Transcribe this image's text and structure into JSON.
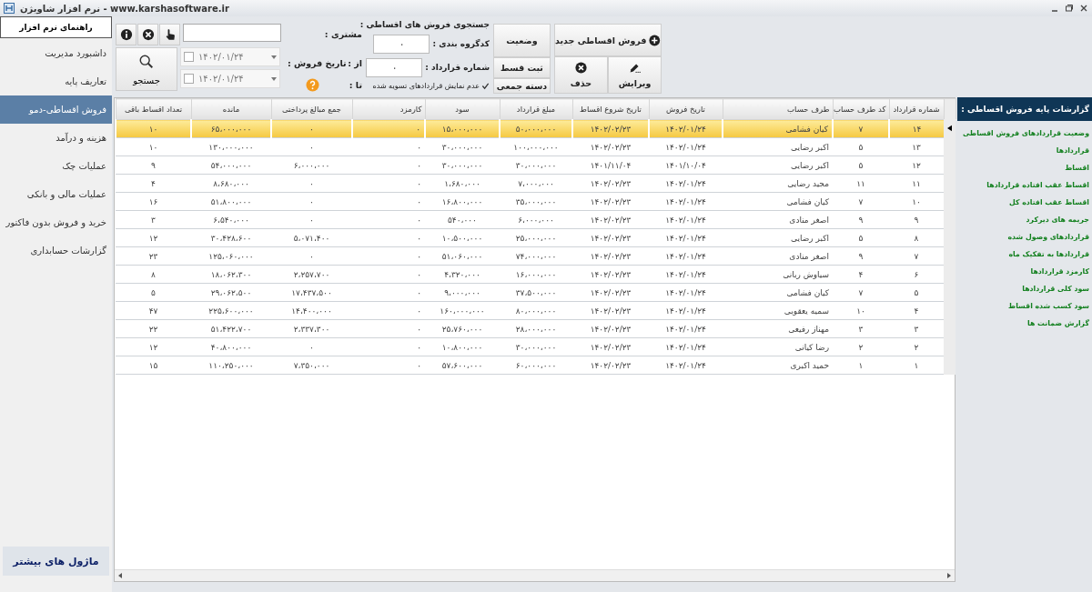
{
  "window": {
    "title": "www.karshasoftware.ir - نرم افزار شاویژن"
  },
  "sidebar": {
    "help_button": "راهنمای نرم افزار",
    "items": [
      {
        "label": "داشبورد مدیریت",
        "selected": false
      },
      {
        "label": "تعاریف پایه",
        "selected": false
      },
      {
        "label": "فروش اقساطی-دمو",
        "selected": true
      },
      {
        "label": "هزینه و درآمد",
        "selected": false
      },
      {
        "label": "عملیات چک",
        "selected": false
      },
      {
        "label": "عملیات مالی و بانکی",
        "selected": false
      },
      {
        "label": "خرید و فروش بدون فاکتور",
        "selected": false
      },
      {
        "label": "گزارشات حسابداری",
        "selected": false
      }
    ],
    "more_button": "ماژول های بیشتر"
  },
  "toolbar": {
    "customer_label": "مشتری :",
    "sale_date_label": "تاریخ فروش :",
    "date_from": {
      "label": "از :",
      "value": "۱۴۰۲/۰۱/۲۴",
      "checked": false
    },
    "date_to": {
      "label": "تا :",
      "value": "۱۴۰۲/۰۱/۲۴",
      "checked": false
    },
    "search_button": "جستجو",
    "filter": {
      "title": "جستجوی فروش های اقساطی :",
      "group_code": {
        "label": "کدگروه بندی :",
        "value": "۰"
      },
      "contract_no": {
        "label": "شماره قرارداد :",
        "value": "۰"
      },
      "hide_settled": {
        "label": "عدم نمایش قراردادهای تسویه شده",
        "checked": true
      }
    },
    "side_buttons": [
      "وضعیت",
      "ثبت قسط",
      "دسته جمعی"
    ],
    "new_button": "فروش اقساطی جدید",
    "actions": [
      {
        "kind": "edit",
        "label": "ویرایش"
      },
      {
        "kind": "delete",
        "label": "حذف"
      }
    ]
  },
  "table": {
    "columns": [
      "شماره قرارداد",
      "کد طرف حساب",
      "طرف حساب",
      "تاریخ فروش",
      "تاریخ شروع اقساط",
      "مبلغ قرارداد",
      "سود",
      "کارمزد",
      "جمع مبالغ پرداختی",
      "مانده",
      "تعداد اقساط باقی"
    ],
    "rows": [
      {
        "selected": true,
        "cells": [
          "۱۴",
          "۷",
          "کیان فشامی",
          "۱۴۰۲/۰۱/۲۴",
          "۱۴۰۲/۰۲/۲۳",
          "۵۰،۰۰۰،۰۰۰",
          "۱۵،۰۰۰،۰۰۰",
          "۰",
          "۰",
          "۶۵،۰۰۰،۰۰۰",
          "۱۰"
        ]
      },
      {
        "selected": false,
        "cells": [
          "۱۳",
          "۵",
          "اکبر رضایی",
          "۱۴۰۲/۰۱/۲۴",
          "۱۴۰۲/۰۲/۲۳",
          "۱۰۰،۰۰۰،۰۰۰",
          "۳۰،۰۰۰،۰۰۰",
          "۰",
          "۰",
          "۱۳۰،۰۰۰،۰۰۰",
          "۱۰"
        ]
      },
      {
        "selected": false,
        "cells": [
          "۱۲",
          "۵",
          "اکبر رضایی",
          "۱۴۰۱/۱۰/۰۴",
          "۱۴۰۱/۱۱/۰۴",
          "۳۰،۰۰۰،۰۰۰",
          "۳۰،۰۰۰،۰۰۰",
          "۰",
          "۶،۰۰۰،۰۰۰",
          "۵۴،۰۰۰،۰۰۰",
          "۹"
        ]
      },
      {
        "selected": false,
        "cells": [
          "۱۱",
          "۱۱",
          "مجید رضایی",
          "۱۴۰۲/۰۱/۲۴",
          "۱۴۰۲/۰۲/۲۳",
          "۷،۰۰۰،۰۰۰",
          "۱،۶۸۰،۰۰۰",
          "۰",
          "۰",
          "۸،۶۸۰،۰۰۰",
          "۴"
        ]
      },
      {
        "selected": false,
        "cells": [
          "۱۰",
          "۷",
          "کیان فشامی",
          "۱۴۰۲/۰۱/۲۴",
          "۱۴۰۲/۰۲/۲۳",
          "۳۵،۰۰۰،۰۰۰",
          "۱۶،۸۰۰،۰۰۰",
          "۰",
          "۰",
          "۵۱،۸۰۰،۰۰۰",
          "۱۶"
        ]
      },
      {
        "selected": false,
        "cells": [
          "۹",
          "۹",
          "اصغر منادی",
          "۱۴۰۲/۰۱/۲۴",
          "۱۴۰۲/۰۲/۲۳",
          "۶،۰۰۰،۰۰۰",
          "۵۴۰،۰۰۰",
          "۰",
          "۰",
          "۶،۵۴۰،۰۰۰",
          "۳"
        ]
      },
      {
        "selected": false,
        "cells": [
          "۸",
          "۵",
          "اکبر رضایی",
          "۱۴۰۲/۰۱/۲۴",
          "۱۴۰۲/۰۲/۲۳",
          "۲۵،۰۰۰،۰۰۰",
          "۱۰،۵۰۰،۰۰۰",
          "۰",
          "۵،۰۷۱،۴۰۰",
          "۳۰،۴۲۸،۶۰۰",
          "۱۲"
        ]
      },
      {
        "selected": false,
        "cells": [
          "۷",
          "۹",
          "اصغر منادی",
          "۱۴۰۲/۰۱/۲۴",
          "۱۴۰۲/۰۲/۲۳",
          "۷۴،۰۰۰،۰۰۰",
          "۵۱،۰۶۰،۰۰۰",
          "۰",
          "۰",
          "۱۲۵،۰۶۰،۰۰۰",
          "۲۳"
        ]
      },
      {
        "selected": false,
        "cells": [
          "۶",
          "۴",
          "سیاوش ربانی",
          "۱۴۰۲/۰۱/۲۴",
          "۱۴۰۲/۰۲/۲۳",
          "۱۶،۰۰۰،۰۰۰",
          "۴،۳۲۰،۰۰۰",
          "۰",
          "۲،۲۵۷،۷۰۰",
          "۱۸،۰۶۲،۳۰۰",
          "۸"
        ]
      },
      {
        "selected": false,
        "cells": [
          "۵",
          "۷",
          "کیان فشامی",
          "۱۴۰۲/۰۱/۲۴",
          "۱۴۰۲/۰۲/۲۳",
          "۳۷،۵۰۰،۰۰۰",
          "۹،۰۰۰،۰۰۰",
          "۰",
          "۱۷،۴۳۷،۵۰۰",
          "۲۹،۰۶۲،۵۰۰",
          "۵"
        ]
      },
      {
        "selected": false,
        "cells": [
          "۴",
          "۱۰",
          "سمیه یعقوبی",
          "۱۴۰۲/۰۱/۲۴",
          "۱۴۰۲/۰۲/۲۳",
          "۸۰،۰۰۰،۰۰۰",
          "۱۶۰،۰۰۰،۰۰۰",
          "۰",
          "۱۴،۴۰۰،۰۰۰",
          "۲۲۵،۶۰۰،۰۰۰",
          "۴۷"
        ]
      },
      {
        "selected": false,
        "cells": [
          "۳",
          "۳",
          "مهناز رفیعی",
          "۱۴۰۲/۰۱/۲۴",
          "۱۴۰۲/۰۲/۲۳",
          "۲۸،۰۰۰،۰۰۰",
          "۲۵،۷۶۰،۰۰۰",
          "۰",
          "۲،۳۳۷،۳۰۰",
          "۵۱،۴۲۲،۷۰۰",
          "۲۲"
        ]
      },
      {
        "selected": false,
        "cells": [
          "۲",
          "۲",
          "رضا کیانی",
          "۱۴۰۲/۰۱/۲۴",
          "۱۴۰۲/۰۲/۲۳",
          "۳۰،۰۰۰،۰۰۰",
          "۱۰،۸۰۰،۰۰۰",
          "۰",
          "۰",
          "۴۰،۸۰۰،۰۰۰",
          "۱۲"
        ]
      },
      {
        "selected": false,
        "cells": [
          "۱",
          "۱",
          "حمید اکبری",
          "۱۴۰۲/۰۱/۲۴",
          "۱۴۰۲/۰۲/۲۳",
          "۶۰،۰۰۰،۰۰۰",
          "۵۷،۶۰۰،۰۰۰",
          "۰",
          "۷،۳۵۰،۰۰۰",
          "۱۱۰،۲۵۰،۰۰۰",
          "۱۵"
        ]
      }
    ]
  },
  "reports": {
    "title": "گزارشات پایه فروش اقساطی :",
    "items": [
      "وضعیت قراردادهای فروش اقساطی",
      "قراردادها",
      "اقساط",
      "اقساط عقب افتاده قراردادها",
      "اقساط عقب افتاده کل",
      "جریمه های دیرکرد",
      "قراردادهای وصول شده",
      "قراردادها به تفکیک ماه",
      "کارمزد قراردادها",
      "سود کلی قراردادها",
      "سود کسب شده اقساط",
      "گزارش ضمانت ها"
    ]
  }
}
